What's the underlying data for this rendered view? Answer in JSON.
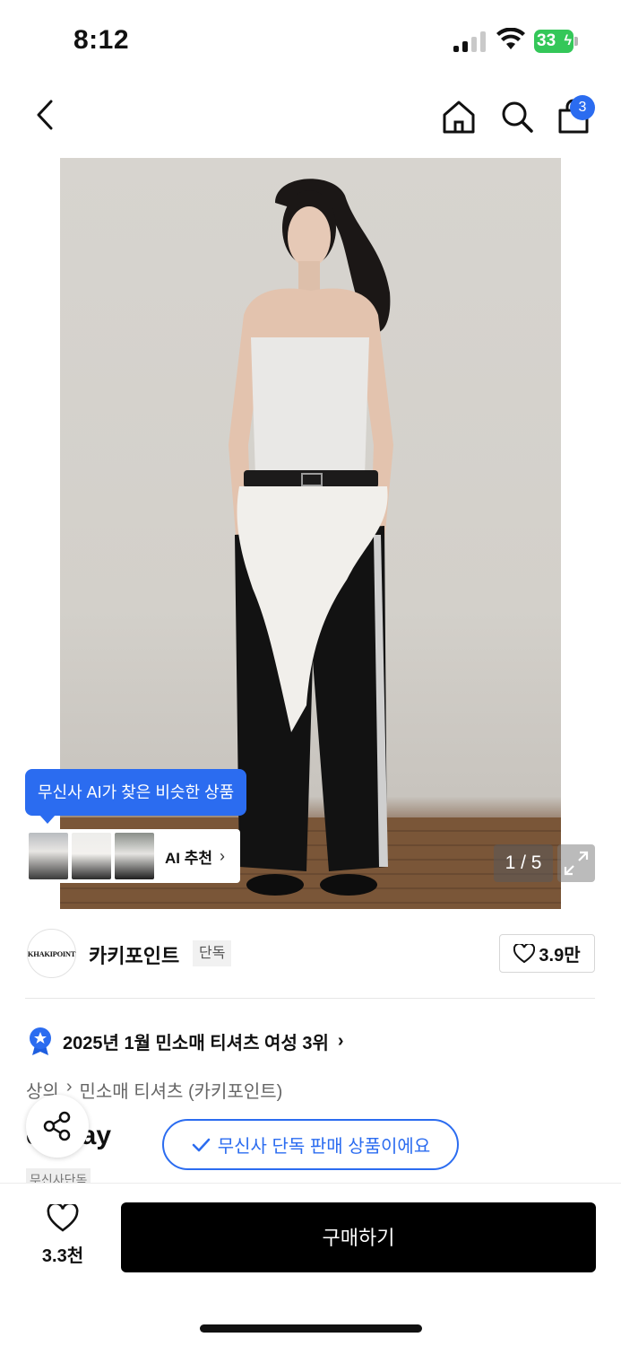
{
  "status_bar": {
    "time": "8:12",
    "battery": "33"
  },
  "nav": {
    "cart_count": "3"
  },
  "hero": {
    "ai_tooltip": "무신사 AI가 찾은 비슷한 상품",
    "ai_card_label": "AI 추천",
    "image_counter": "1 / 5"
  },
  "brand": {
    "logo_text": "KHAKIPOINT",
    "name": "카키포인트",
    "exclusive_badge": "단독",
    "likes": "3.9만"
  },
  "ranking": {
    "text": "2025년 1월 민소매 티셔츠 여성 3위"
  },
  "breadcrumb": {
    "level1": "상의",
    "level2": "민소매 티셔츠 (카키포인트)"
  },
  "product": {
    "title_peek": "ed Lay",
    "tag_peek": "무신사단독"
  },
  "exclusive_notice": "무신사 단독 판매 상품이에요",
  "bottom_bar": {
    "wish_count": "3.3천",
    "buy_label": "구매하기"
  },
  "colors": {
    "accent": "#2b6cf0",
    "buy_button": "#000000",
    "battery": "#34c759"
  }
}
